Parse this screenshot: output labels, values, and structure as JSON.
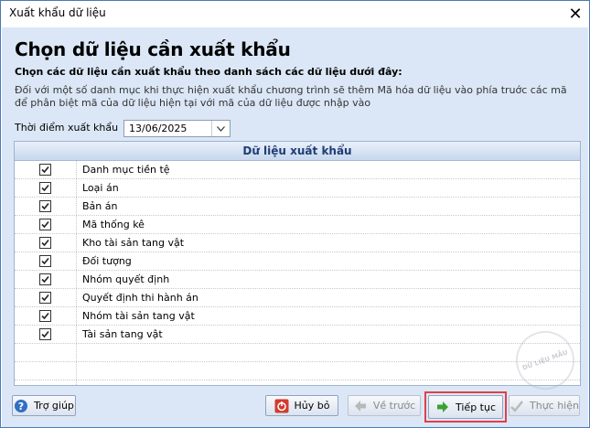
{
  "window": {
    "title": "Xuất khẩu dữ liệu"
  },
  "header": {
    "title": "Chọn dữ liệu cần xuất khẩu",
    "subtitle": "Chọn các dữ liệu cần xuất khẩu theo danh sách các dữ liệu dưới đây:",
    "description": "Đối với một số danh mục khi thực hiện xuất khẩu chương trình sẽ thêm Mã hóa dữ liệu vào phía truớc các mã để phân biệt mã của dữ liệu hiện tại với mã của dữ liệu được nhập vào"
  },
  "export_date": {
    "label": "Thời điểm xuất khẩu",
    "value": "13/06/2025"
  },
  "grid": {
    "header": "Dữ liệu xuất khẩu",
    "rows": [
      {
        "name": "Danh mục tiền tệ",
        "checked": true
      },
      {
        "name": "Loại án",
        "checked": true
      },
      {
        "name": "Bản án",
        "checked": true
      },
      {
        "name": "Mã thống kê",
        "checked": true
      },
      {
        "name": "Kho tài sản tang vật",
        "checked": true
      },
      {
        "name": "Đối tượng",
        "checked": true
      },
      {
        "name": "Nhóm quyết định",
        "checked": true
      },
      {
        "name": "Quyết định thi hành án",
        "checked": true
      },
      {
        "name": "Nhóm tài sản tang vật",
        "checked": true
      },
      {
        "name": "Tài sản tang vật",
        "checked": true
      }
    ]
  },
  "buttons": {
    "help": "Trợ giúp",
    "cancel": "Hủy bỏ",
    "back": "Về trước",
    "next": "Tiếp tục",
    "finish": "Thực hiện"
  },
  "watermark": "DỮ LIỆU MẪU"
}
